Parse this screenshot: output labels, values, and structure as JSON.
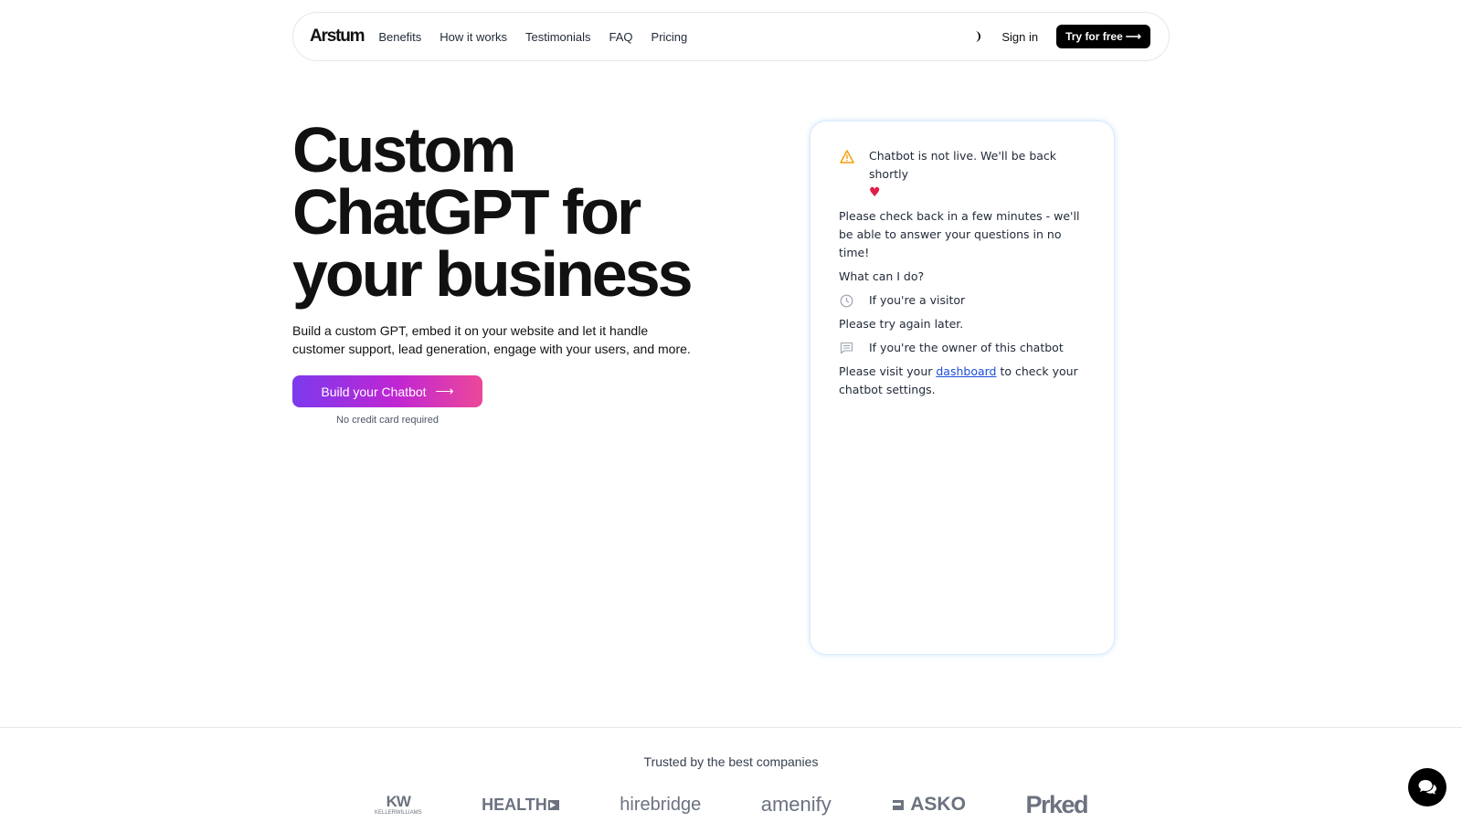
{
  "nav": {
    "logo": "Arstum",
    "links": [
      "Benefits",
      "How it works",
      "Testimonials",
      "FAQ",
      "Pricing"
    ],
    "theme_icon": "moon-icon",
    "signin_label": "Sign in",
    "try_label": "Try for free",
    "try_arrow": "⟶"
  },
  "hero": {
    "title_line1": "Custom",
    "title_line2": "ChatGPT for",
    "title_line3": "your business",
    "subtitle": "Build a custom GPT, embed it on your website and let it handle customer support, lead generation, engage with your users, and more.",
    "cta_label": "Build your Chatbot",
    "cta_arrow": "⟶",
    "cta_note": "No credit card required"
  },
  "chat": {
    "status_text": "Chatbot is not live. We'll be back shortly",
    "status_emoji": "♥",
    "check_back": "Please check back in a few minutes - we'll be able to answer your questions in no time!",
    "what_can": "What can I do?",
    "visitor_label": "If you're a visitor",
    "visitor_text": "Please try again later.",
    "owner_label": "If you're the owner of this chatbot",
    "owner_text_pre": "Please visit your",
    "owner_link": "dashboard",
    "owner_text_post": "to check your chatbot settings.",
    "warning_icon": "warning-icon",
    "clock_icon": "clock-icon",
    "message_icon": "message-icon"
  },
  "trusted": {
    "heading": "Trusted by the best companies",
    "logos": [
      {
        "name": "KW",
        "sub": "KELLERWILLIAMS"
      },
      {
        "name": "HEALTH"
      },
      {
        "name": "hirebridge"
      },
      {
        "name": "amenify"
      },
      {
        "name": "ASKO"
      },
      {
        "name": "Prked"
      }
    ]
  },
  "colors": {
    "cta_start": "#7c3aed",
    "cta_end": "#ec4899",
    "link": "#1d4ed8",
    "warning": "#f59e0b"
  }
}
